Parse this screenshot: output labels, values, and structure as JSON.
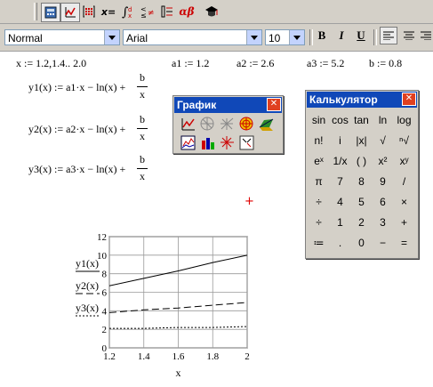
{
  "toolbar_top": {
    "icons": [
      "calculator-palette-icon",
      "graph-palette-icon",
      "matrix-palette-icon",
      "evaluation-palette-icon",
      "calculus-palette-icon",
      "boolean-palette-icon",
      "programming-palette-icon",
      "greek-palette-icon",
      "symbolic-palette-icon"
    ],
    "eval_label": "x=",
    "greek_label": "αβ"
  },
  "format_bar": {
    "style_value": "Normal",
    "font_value": "Arial",
    "size_value": "10",
    "bold_label": "B",
    "italic_label": "I",
    "underline_label": "U"
  },
  "worksheet": {
    "range_def": "x := 1.2,1.4.. 2.0",
    "a1_def": "a1 := 1.2",
    "a2_def": "a2 := 2.6",
    "a3_def": "a3 := 5.2",
    "b_def": "b := 0.8",
    "y1_def": "y1(x) := a1·x − ln(x) +",
    "y2_def": "y2(x) := a2·x − ln(x) +",
    "y3_def": "y3(x) := a3·x − ln(x) +",
    "frac_num": "b",
    "frac_den": "x"
  },
  "graph_palette": {
    "title": "График",
    "close": "✕",
    "tools": [
      "xy-plot-icon",
      "polar-plot-icon",
      "surface-plot-icon",
      "contour-plot-icon",
      "3d-scatter-icon",
      "3d-bar-icon",
      "vector-field-icon",
      "zoom-icon",
      "trace-icon",
      "plot-wizard-icon"
    ]
  },
  "calculator_palette": {
    "title": "Калькулятор",
    "close": "✕",
    "rows": [
      [
        "sin",
        "cos",
        "tan",
        "ln",
        "log"
      ],
      [
        "n!",
        "i",
        "|x|",
        "√",
        "ⁿ√"
      ],
      [
        "eˣ",
        "1/x",
        "( )",
        "x²",
        "xʸ"
      ],
      [
        "π",
        "7",
        "8",
        "9",
        "/"
      ],
      [
        "÷",
        "4",
        "5",
        "6",
        "×"
      ],
      [
        "÷",
        "1",
        "2",
        "3",
        "+"
      ],
      [
        "≔",
        ".",
        "0",
        "−",
        "="
      ]
    ]
  },
  "cursor_mark": "+",
  "chart_data": {
    "type": "line",
    "x": [
      1.2,
      1.4,
      1.6,
      1.8,
      2.0
    ],
    "series": [
      {
        "name": "y1(x)",
        "values": [
          6.7,
          7.5,
          8.3,
          9.2,
          10.0
        ],
        "style": "solid"
      },
      {
        "name": "y2(x)",
        "values": [
          3.8,
          4.1,
          4.3,
          4.6,
          4.9
        ],
        "style": "dashed"
      },
      {
        "name": "y3(x)",
        "values": [
          2.1,
          2.1,
          2.2,
          2.2,
          2.3
        ],
        "style": "dotted"
      }
    ],
    "xlim": [
      1.2,
      2.0
    ],
    "ylim": [
      0,
      12
    ],
    "xticks": [
      "1.2",
      "1.4",
      "1.6",
      "1.8",
      "2"
    ],
    "yticks": [
      "0",
      "2",
      "4",
      "6",
      "8",
      "10",
      "12"
    ],
    "xlabel": "x",
    "grid": true
  }
}
